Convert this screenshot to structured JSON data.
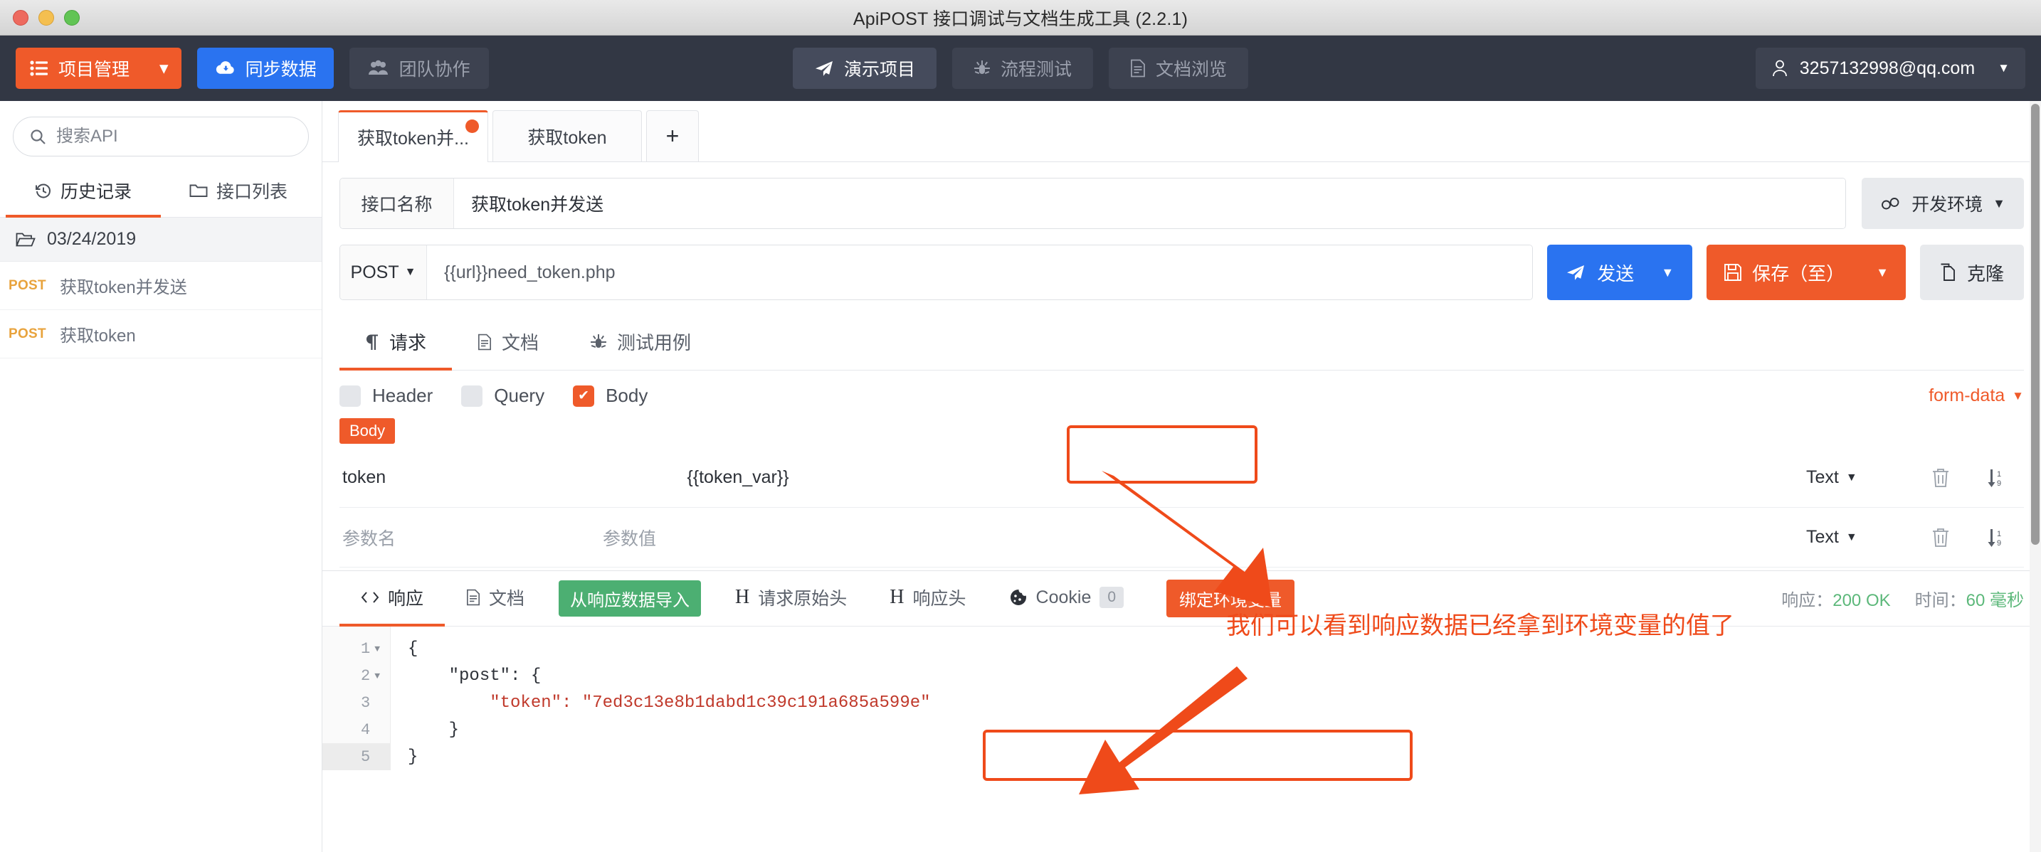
{
  "window": {
    "title": "ApiPOST 接口调试与文档生成工具 (2.2.1)"
  },
  "topnav": {
    "project_button": "项目管理",
    "sync_button": "同步数据",
    "team_button": "团队协作",
    "center_items": [
      {
        "label": "演示项目",
        "icon": "send-icon",
        "active": true
      },
      {
        "label": "流程测试",
        "icon": "bug-icon",
        "active": false
      },
      {
        "label": "文档浏览",
        "icon": "document-icon",
        "active": false
      }
    ],
    "user": "3257132998@qq.com"
  },
  "sidebar": {
    "search_placeholder": "搜索API",
    "tabs": [
      {
        "label": "历史记录",
        "icon": "history-icon",
        "active": true
      },
      {
        "label": "接口列表",
        "icon": "folder-icon",
        "active": false
      }
    ],
    "folder": "03/24/2019",
    "items": [
      {
        "method": "POST",
        "name": "获取token并发送"
      },
      {
        "method": "POST",
        "name": "获取token"
      }
    ]
  },
  "tabstrip": {
    "tabs": [
      {
        "label": "获取token并...",
        "active": true,
        "dirty": true
      },
      {
        "label": "获取token",
        "active": false,
        "dirty": false
      }
    ],
    "add_label": "+"
  },
  "request": {
    "name_label": "接口名称",
    "name_value": "获取token并发送",
    "env_button": "开发环境",
    "method": "POST",
    "url": "{{url}}need_token.php",
    "send_button": "发送",
    "save_button": "保存（至）",
    "clone_button": "克隆",
    "tabs": [
      {
        "label": "请求",
        "icon": "paragraph-icon",
        "active": true
      },
      {
        "label": "文档",
        "icon": "document-icon",
        "active": false
      },
      {
        "label": "测试用例",
        "icon": "bug-icon",
        "active": false
      }
    ],
    "checkboxes": [
      {
        "label": "Header",
        "checked": false
      },
      {
        "label": "Query",
        "checked": false
      },
      {
        "label": "Body",
        "checked": true
      }
    ],
    "content_type": "form-data",
    "body_badge": "Body",
    "params": [
      {
        "name": "token",
        "value": "{{token_var}}",
        "type": "Text",
        "placeholder": false
      },
      {
        "name": "参数名",
        "value": "参数值",
        "type": "Text",
        "placeholder": true
      }
    ]
  },
  "response": {
    "tabs": [
      {
        "label": "响应",
        "icon": "code-icon",
        "active": true
      },
      {
        "label": "文档",
        "icon": "document-icon",
        "active": false
      },
      {
        "label": "请求原始头",
        "icon": "h-icon",
        "active": false
      },
      {
        "label": "响应头",
        "icon": "h-icon",
        "active": false
      },
      {
        "label": "Cookie",
        "icon": "cookie-icon",
        "active": false,
        "badge": "0"
      }
    ],
    "import_button": "从响应数据导入",
    "bind_button": "绑定环境变量",
    "status_label": "响应：",
    "status_value": "200 OK",
    "time_label": "时间：",
    "time_value": "60 毫秒",
    "code_lines": [
      {
        "no": "1",
        "fold": true,
        "text": "{"
      },
      {
        "no": "2",
        "fold": true,
        "text": "    \"post\": {"
      },
      {
        "no": "3",
        "fold": false,
        "text": "        \"token\": \"7ed3c13e8b1dabd1c39c191a685a599e\""
      },
      {
        "no": "4",
        "fold": false,
        "text": "    }"
      },
      {
        "no": "5",
        "fold": false,
        "text": "}"
      }
    ],
    "json_key_post": "\"post\"",
    "json_key_token": "\"token\"",
    "json_token_value": "\"7ed3c13e8b1dabd1c39c191a685a599e\""
  },
  "annotation": {
    "text": "我们可以看到响应数据已经拿到环境变量的值了",
    "color": "#ef4a1a"
  }
}
